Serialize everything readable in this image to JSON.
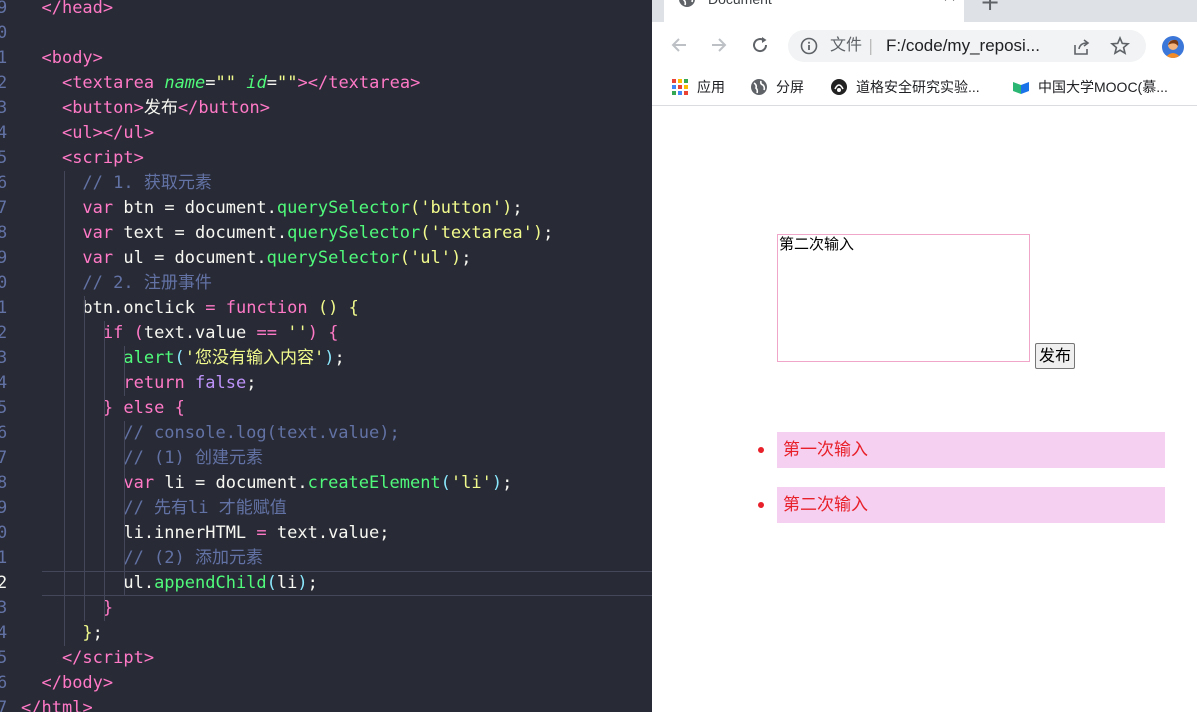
{
  "editor": {
    "gutter_numbers": [
      "9",
      "0",
      "1",
      "2",
      "3",
      "4",
      "5",
      "6",
      "7",
      "8",
      "9",
      "0",
      "1",
      "2",
      "3",
      "4",
      "5",
      "6",
      "7",
      "8",
      "9",
      "0",
      "1",
      "2",
      "3",
      "4",
      "5",
      "6",
      "7"
    ],
    "active_line_index": 23,
    "lines": [
      [
        [
          "  </",
          "tk-tag"
        ],
        [
          "head",
          "tk-tag"
        ],
        [
          ">",
          "tk-tag"
        ]
      ],
      [],
      [
        [
          "  <",
          "tk-tag"
        ],
        [
          "body",
          "tk-tag"
        ],
        [
          ">",
          "tk-tag"
        ]
      ],
      [
        [
          "    <",
          "tk-tag"
        ],
        [
          "textarea",
          "tk-tag"
        ],
        [
          " ",
          "tk-plain"
        ],
        [
          "name",
          "tk-attr"
        ],
        [
          "=",
          "tk-plain"
        ],
        [
          "\"\"",
          "tk-str"
        ],
        [
          " ",
          "tk-plain"
        ],
        [
          "id",
          "tk-attr"
        ],
        [
          "=",
          "tk-plain"
        ],
        [
          "\"\"",
          "tk-str"
        ],
        [
          "></",
          "tk-tag"
        ],
        [
          "textarea",
          "tk-tag"
        ],
        [
          ">",
          "tk-tag"
        ]
      ],
      [
        [
          "    <",
          "tk-tag"
        ],
        [
          "button",
          "tk-tag"
        ],
        [
          ">",
          "tk-tag"
        ],
        [
          "发布",
          "tk-plain"
        ],
        [
          "</",
          "tk-tag"
        ],
        [
          "button",
          "tk-tag"
        ],
        [
          ">",
          "tk-tag"
        ]
      ],
      [
        [
          "    <",
          "tk-tag"
        ],
        [
          "ul",
          "tk-tag"
        ],
        [
          "></",
          "tk-tag"
        ],
        [
          "ul",
          "tk-tag"
        ],
        [
          ">",
          "tk-tag"
        ]
      ],
      [
        [
          "    <",
          "tk-tag"
        ],
        [
          "script",
          "tk-tag"
        ],
        [
          ">",
          "tk-tag"
        ]
      ],
      [
        [
          "      // 1. 获取元素",
          "tk-cm"
        ]
      ],
      [
        [
          "      ",
          "tk-plain"
        ],
        [
          "var",
          "tk-kw"
        ],
        [
          " btn = document.",
          "tk-plain"
        ],
        [
          "querySelector",
          "tk-fn"
        ],
        [
          "(",
          "tk-paren"
        ],
        [
          "'button'",
          "tk-str"
        ],
        [
          ")",
          "tk-paren"
        ],
        [
          ";",
          "tk-plain"
        ]
      ],
      [
        [
          "      ",
          "tk-plain"
        ],
        [
          "var",
          "tk-kw"
        ],
        [
          " text = document.",
          "tk-plain"
        ],
        [
          "querySelector",
          "tk-fn"
        ],
        [
          "(",
          "tk-paren"
        ],
        [
          "'textarea'",
          "tk-str"
        ],
        [
          ")",
          "tk-paren"
        ],
        [
          ";",
          "tk-plain"
        ]
      ],
      [
        [
          "      ",
          "tk-plain"
        ],
        [
          "var",
          "tk-kw"
        ],
        [
          " ul = document.",
          "tk-plain"
        ],
        [
          "querySelector",
          "tk-fn"
        ],
        [
          "(",
          "tk-paren"
        ],
        [
          "'ul'",
          "tk-str"
        ],
        [
          ")",
          "tk-paren"
        ],
        [
          ";",
          "tk-plain"
        ]
      ],
      [
        [
          "      // 2. 注册事件",
          "tk-cm"
        ]
      ],
      [
        [
          "      btn.onclick ",
          "tk-plain"
        ],
        [
          "=",
          "tk-kw"
        ],
        [
          " ",
          "tk-plain"
        ],
        [
          "function",
          "tk-kw"
        ],
        [
          " ",
          "tk-plain"
        ],
        [
          "()",
          "tk-paren"
        ],
        [
          " ",
          "tk-plain"
        ],
        [
          "{",
          "tk-paren"
        ]
      ],
      [
        [
          "        ",
          "tk-plain"
        ],
        [
          "if",
          "tk-kw"
        ],
        [
          " ",
          "tk-plain"
        ],
        [
          "(",
          "tk-paren2"
        ],
        [
          "text.value ",
          "tk-plain"
        ],
        [
          "==",
          "tk-kw"
        ],
        [
          " ",
          "tk-plain"
        ],
        [
          "''",
          "tk-str"
        ],
        [
          ")",
          "tk-paren2"
        ],
        [
          " ",
          "tk-plain"
        ],
        [
          "{",
          "tk-paren2"
        ]
      ],
      [
        [
          "          ",
          "tk-plain"
        ],
        [
          "alert",
          "tk-fn"
        ],
        [
          "(",
          "tk-paren3"
        ],
        [
          "'您没有输入内容'",
          "tk-str"
        ],
        [
          ")",
          "tk-paren3"
        ],
        [
          ";",
          "tk-plain"
        ]
      ],
      [
        [
          "          ",
          "tk-plain"
        ],
        [
          "return",
          "tk-kw"
        ],
        [
          " ",
          "tk-plain"
        ],
        [
          "false",
          "tk-bool"
        ],
        [
          ";",
          "tk-plain"
        ]
      ],
      [
        [
          "        ",
          "tk-plain"
        ],
        [
          "}",
          "tk-paren2"
        ],
        [
          " ",
          "tk-plain"
        ],
        [
          "else",
          "tk-kw"
        ],
        [
          " ",
          "tk-plain"
        ],
        [
          "{",
          "tk-paren2"
        ]
      ],
      [
        [
          "          // console.log(text.value);",
          "tk-cm"
        ]
      ],
      [
        [
          "          // (1) 创建元素",
          "tk-cm"
        ]
      ],
      [
        [
          "          ",
          "tk-plain"
        ],
        [
          "var",
          "tk-kw"
        ],
        [
          " li = document.",
          "tk-plain"
        ],
        [
          "createElement",
          "tk-fn"
        ],
        [
          "(",
          "tk-paren3"
        ],
        [
          "'li'",
          "tk-str"
        ],
        [
          ")",
          "tk-paren3"
        ],
        [
          ";",
          "tk-plain"
        ]
      ],
      [
        [
          "          // 先有li 才能赋值",
          "tk-cm"
        ]
      ],
      [
        [
          "          li.innerHTML ",
          "tk-plain"
        ],
        [
          "=",
          "tk-kw"
        ],
        [
          " text.value;",
          "tk-plain"
        ]
      ],
      [
        [
          "          // (2) 添加元素",
          "tk-cm"
        ]
      ],
      [
        [
          "          ul.",
          "tk-plain"
        ],
        [
          "appendChild",
          "tk-fn"
        ],
        [
          "(",
          "tk-paren3"
        ],
        [
          "li",
          "tk-plain"
        ],
        [
          ")",
          "tk-paren3"
        ],
        [
          ";",
          "tk-plain"
        ]
      ],
      [
        [
          "        ",
          "tk-plain"
        ],
        [
          "}",
          "tk-paren2"
        ]
      ],
      [
        [
          "      ",
          "tk-plain"
        ],
        [
          "}",
          "tk-paren"
        ],
        [
          ";",
          "tk-plain"
        ]
      ],
      [
        [
          "    </",
          "tk-tag"
        ],
        [
          "script",
          "tk-tag"
        ],
        [
          ">",
          "tk-tag"
        ]
      ],
      [
        [
          "  </",
          "tk-tag"
        ],
        [
          "body",
          "tk-tag"
        ],
        [
          ">",
          "tk-tag"
        ]
      ],
      [
        [
          "</",
          "tk-tag"
        ],
        [
          "html",
          "tk-tag"
        ],
        [
          ">",
          "tk-tag"
        ]
      ]
    ]
  },
  "browser": {
    "tab_title": "Document",
    "tab_close_label": "✕",
    "new_tab_label": "+",
    "address_prefix": "文件",
    "address_separator": "|",
    "address_url": "F:/code/my_reposi...",
    "bookmarks": [
      {
        "label": "应用",
        "icon": "apps-grid-icon"
      },
      {
        "label": "分屏",
        "icon": "globe-icon"
      },
      {
        "label": "道格安全研究实验...",
        "icon": "site-logo-icon"
      },
      {
        "label": "中国大学MOOC(慕...",
        "icon": "mooc-icon"
      }
    ]
  },
  "page": {
    "textarea_value": "第二次输入",
    "publish_button": "发布",
    "posts": [
      "第一次输入",
      "第二次输入"
    ],
    "colors": {
      "post_background": "#f5d0f0",
      "post_text": "#e8202a",
      "textarea_border": "#f0a6c8"
    }
  }
}
